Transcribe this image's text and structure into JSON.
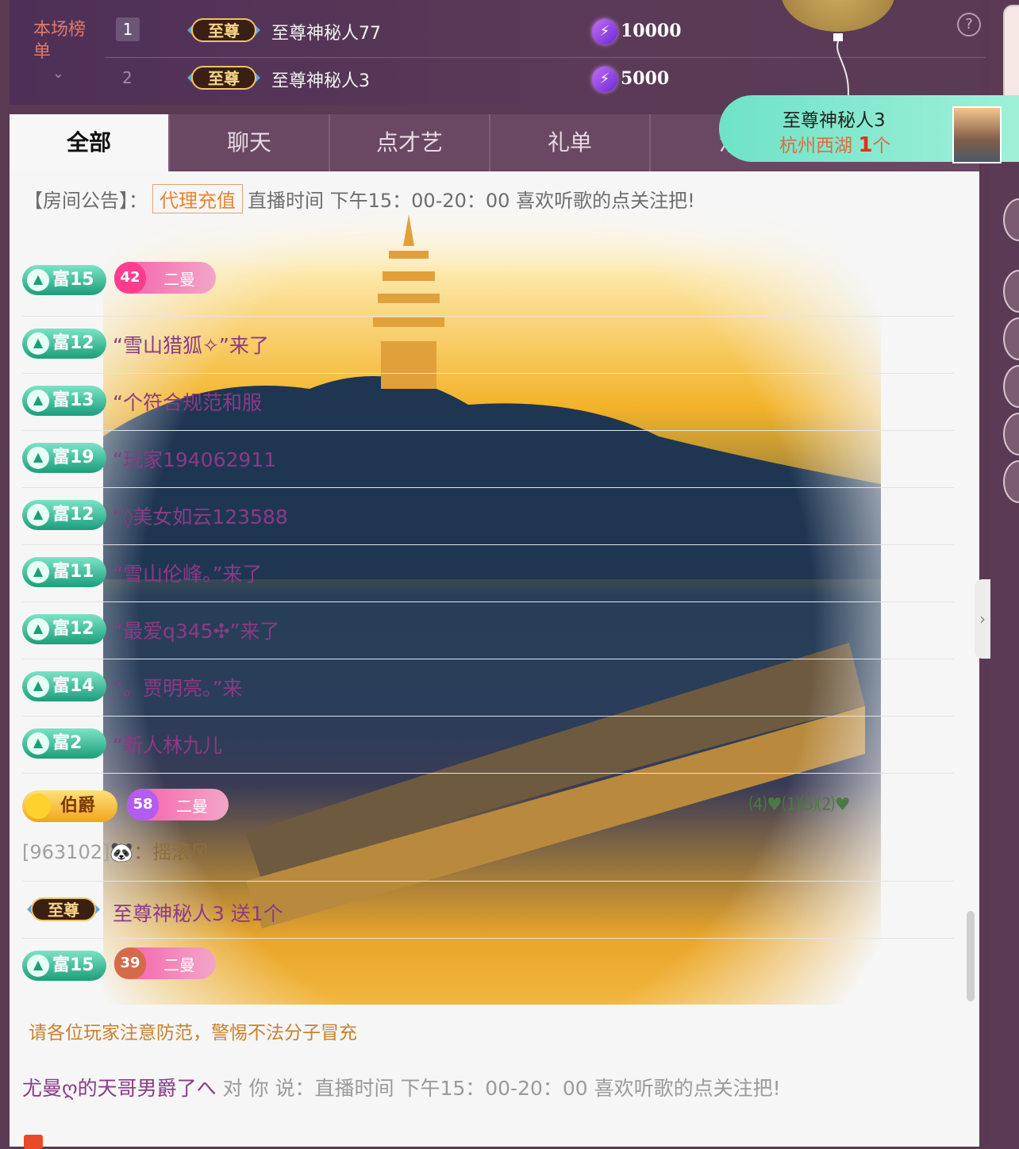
{
  "rank_board": {
    "title": "本场榜单",
    "rows": [
      {
        "rank": "1",
        "badge": "至尊",
        "name": "至尊神秘人77",
        "score": "10000"
      },
      {
        "rank": "2",
        "badge": "至尊",
        "name": "至尊神秘人3",
        "score": "5000"
      }
    ],
    "help": "?"
  },
  "notification": {
    "name": "至尊神秘人3",
    "location": "杭州西湖",
    "count": "1",
    "unit": "个"
  },
  "tabs": [
    "全部",
    "聊天",
    "点才艺",
    "礼单",
    "活"
  ],
  "announcement": {
    "label": "【房间公告】：",
    "tag": "代理充值",
    "text": "直播时间 下午15：00-20：00 喜欢听歌的点关注把!"
  },
  "chat": [
    {
      "rich": "富15",
      "fan_level": "42",
      "fan_name": "二曼",
      "msg": ""
    },
    {
      "rich": "富12",
      "msg": "“雪山猎狐✧”来了"
    },
    {
      "rich": "富13",
      "msg": "“个符合规范和服"
    },
    {
      "rich": "富19",
      "msg": "“玩家194062911"
    },
    {
      "rich": "富12",
      "msg": "“◊美女如云123588"
    },
    {
      "rich": "富11",
      "msg": "“雪山伦峰。”来了"
    },
    {
      "rich": "富12",
      "msg": "“最爱q345✣”来了"
    },
    {
      "rich": "富14",
      "msg": "“。贾明亮。”来"
    },
    {
      "rich": "富2",
      "msg": "“新人林九儿"
    }
  ],
  "duke_row": {
    "title": "伯爵",
    "fan_level": "58",
    "fan_name": "二曼"
  },
  "gift_line": {
    "id": "[963102]",
    "text": "：摇滚风"
  },
  "zz_row": {
    "badge": "至尊",
    "text": "至尊神秘人3 送1个"
  },
  "last_row": {
    "rich": "富15",
    "fan_level": "39",
    "fan_name": "二曼"
  },
  "hand_text": "⑷♥⑴⑸⑵♥",
  "warning": "请各位玩家注意防范，警惕不法分子冒充",
  "whisper": {
    "from": "尤曼ღ的天哥男爵了へ",
    "rest": " 对 你 说：直播时间 下午15：00-20：00 喜欢听歌的点关注把!"
  }
}
